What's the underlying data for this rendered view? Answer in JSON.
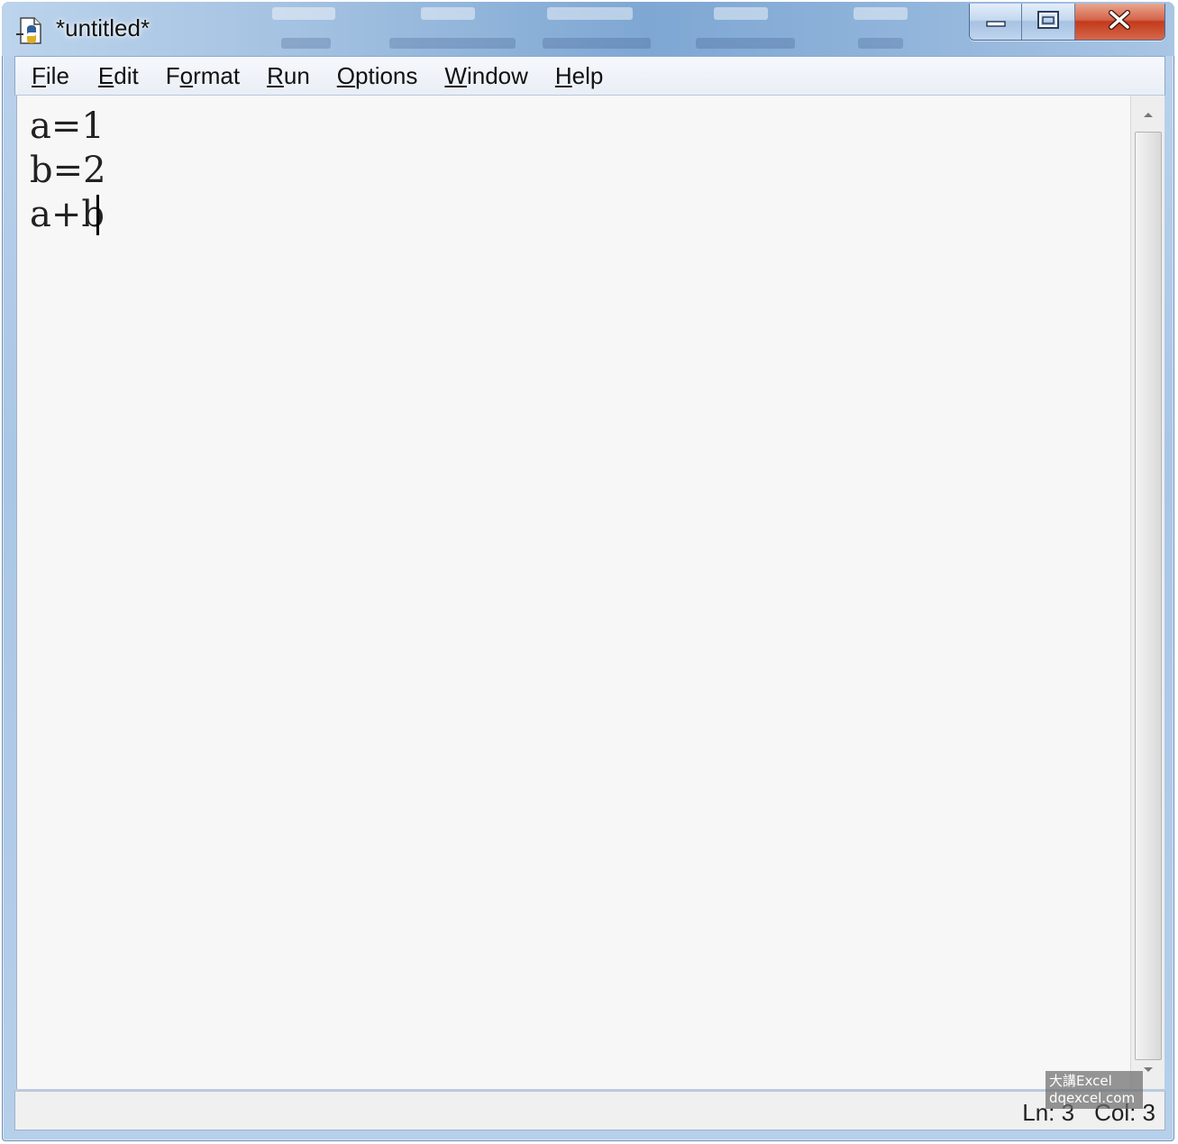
{
  "window": {
    "title": "*untitled*",
    "icon": "python-idle-icon",
    "caption_buttons": {
      "minimize_icon": "minimize-icon",
      "maximize_icon": "maximize-icon",
      "close_icon": "close-icon",
      "close_color": "#c33a1c"
    }
  },
  "menu": [
    {
      "first": "F",
      "rest": "ile"
    },
    {
      "first": "E",
      "rest": "dit"
    },
    {
      "first": "F",
      "pre": "",
      "label_pre": "F",
      "label_ul": "o",
      "label_post": "rmat"
    },
    {
      "first": "R",
      "rest": "un"
    },
    {
      "first": "O",
      "rest": "ptions"
    },
    {
      "first": "W",
      "rest": "indow"
    },
    {
      "first": "H",
      "rest": "elp"
    }
  ],
  "editor": {
    "lines": [
      "a=1",
      "b=2",
      "a+b"
    ],
    "background": "#f7f7f7"
  },
  "status": {
    "line": "Ln: 3",
    "col": "Col: 3"
  },
  "watermark": {
    "line1": "大講Excel",
    "line2": "dqexcel.com"
  }
}
